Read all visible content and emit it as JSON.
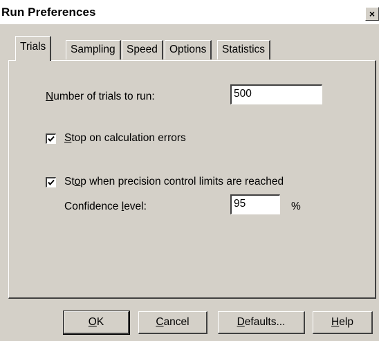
{
  "window": {
    "title": "Run Preferences",
    "close_glyph": "×"
  },
  "tabs": [
    {
      "label": "Trials",
      "active": true
    },
    {
      "label": "Sampling",
      "active": false
    },
    {
      "label": "Speed",
      "active": false
    },
    {
      "label": "Options",
      "active": false
    },
    {
      "label": "Statistics",
      "active": false
    }
  ],
  "trials": {
    "num_trials": {
      "label_mnemonic": "N",
      "label_rest": "umber of trials to run:",
      "value": "500"
    },
    "stop_on_errors": {
      "checked": true,
      "label_mnemonic": "S",
      "label_rest": "top on calculation errors"
    },
    "stop_on_precision": {
      "checked": true,
      "label_before": "St",
      "label_mnemonic": "o",
      "label_rest": "p when precision control limits are reached"
    },
    "confidence": {
      "label_before": "Confidence ",
      "label_mnemonic": "l",
      "label_rest": "evel:",
      "value": "95",
      "unit": "%"
    }
  },
  "buttons": {
    "ok": {
      "mnemonic": "O",
      "rest": "K"
    },
    "cancel": {
      "mnemonic": "C",
      "rest": "ancel"
    },
    "defaults": {
      "mnemonic": "D",
      "rest": "efaults..."
    },
    "help": {
      "mnemonic": "H",
      "rest": "elp"
    }
  }
}
